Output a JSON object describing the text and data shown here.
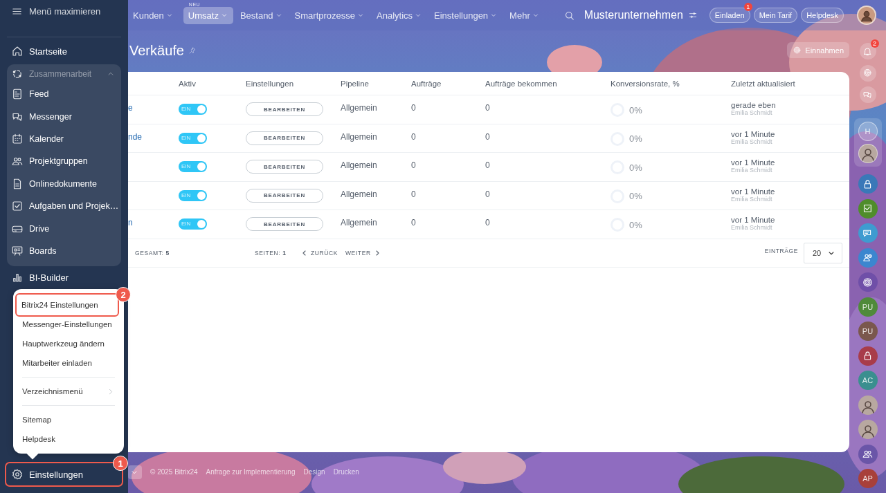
{
  "sidebar": {
    "toggle_label": "Menü maximieren",
    "items": [
      {
        "kind": "home",
        "label": "Startseite"
      }
    ],
    "group": {
      "kind": "collab",
      "label": "Zusammenarbeit",
      "expanded": true,
      "children": [
        {
          "kind": "feed",
          "label": "Feed"
        },
        {
          "kind": "chat",
          "label": "Messenger"
        },
        {
          "kind": "calendar",
          "label": "Kalender"
        },
        {
          "kind": "people",
          "label": "Projektgruppen"
        },
        {
          "kind": "document",
          "label": "Onlinedokumente"
        },
        {
          "kind": "task",
          "label": "Aufgaben und Projek…"
        },
        {
          "kind": "drive",
          "label": "Drive"
        },
        {
          "kind": "board",
          "label": "Boards"
        }
      ]
    },
    "after_items": [
      {
        "kind": "chart",
        "label": "BI-Builder"
      }
    ],
    "settings_item": {
      "kind": "gear",
      "label": "Einstellungen",
      "annotation": "1"
    }
  },
  "settings_menu": {
    "items": [
      {
        "kind": "item",
        "label": "Bitrix24 Einstellungen",
        "annotation": "2"
      },
      {
        "kind": "item",
        "label": "Messenger-Einstellungen"
      },
      {
        "kind": "item",
        "label": "Hauptwerkzeug ändern"
      },
      {
        "kind": "item",
        "label": "Mitarbeiter einladen"
      },
      {
        "kind": "divider"
      },
      {
        "kind": "submenu",
        "label": "Verzeichnismenü"
      },
      {
        "kind": "divider"
      },
      {
        "kind": "item",
        "label": "Sitemap"
      },
      {
        "kind": "item",
        "label": "Helpdesk"
      }
    ]
  },
  "topbar": {
    "nav": [
      {
        "label": "Kunden",
        "selected": false
      },
      {
        "label": "Umsatz",
        "selected": true,
        "badge": "NEU"
      },
      {
        "label": "Bestand",
        "selected": false
      },
      {
        "label": "Smartprozesse",
        "selected": false
      },
      {
        "label": "Analytics",
        "selected": false
      },
      {
        "label": "Einstellungen",
        "selected": false
      },
      {
        "label": "Mehr",
        "selected": false
      }
    ],
    "company": "Musterunternehmen",
    "buttons": [
      {
        "label": "Einladen",
        "badge": "1"
      },
      {
        "label": "Mein Tarif"
      },
      {
        "label": "Helpdesk"
      }
    ]
  },
  "page": {
    "title": "Verkäufe",
    "action": "Einnahmen"
  },
  "table": {
    "columns": [
      "Aktiv",
      "Einstellungen",
      "Pipeline",
      "Aufträge",
      "Aufträge bekommen",
      "Konversionsrate, %",
      "Zuletzt aktualisiert"
    ],
    "rows": [
      {
        "name": "e",
        "active": true,
        "toggle_label": "EIN",
        "settings": "BEARBEITEN",
        "pipeline": "Allgemein",
        "orders": "0",
        "won": "0",
        "conversion": "0%",
        "updated": "gerade eben",
        "author": "Emilia Schmidt"
      },
      {
        "name": "nde",
        "active": true,
        "toggle_label": "EIN",
        "settings": "BEARBEITEN",
        "pipeline": "Allgemein",
        "orders": "0",
        "won": "0",
        "conversion": "0%",
        "updated": "vor 1 Minute",
        "author": "Emilia Schmidt"
      },
      {
        "active": true,
        "toggle_label": "EIN",
        "settings": "BEARBEITEN",
        "pipeline": "Allgemein",
        "orders": "0",
        "won": "0",
        "conversion": "0%",
        "updated": "vor 1 Minute",
        "author": "Emilia Schmidt"
      },
      {
        "active": true,
        "toggle_label": "EIN",
        "settings": "BEARBEITEN",
        "pipeline": "Allgemein",
        "orders": "0",
        "won": "0",
        "conversion": "0%",
        "updated": "vor 1 Minute",
        "author": "Emilia Schmidt"
      },
      {
        "name": "n",
        "active": true,
        "toggle_label": "EIN",
        "settings": "BEARBEITEN",
        "pipeline": "Allgemein",
        "orders": "0",
        "won": "0",
        "conversion": "0%",
        "updated": "vor 1 Minute",
        "author": "Emilia Schmidt"
      }
    ],
    "pagination": {
      "total": "GESAMT: **5**",
      "pages": "SEITEN: **1**",
      "prev": "ZURÜCK",
      "next": "WEITER",
      "per_page_label": "EINTRÄGE",
      "per_page": "20"
    }
  },
  "footer": {
    "copyright": "© 2025 Bitrix24",
    "links": [
      "Anfrage zur Implementierung",
      "Design",
      "Drucken"
    ]
  },
  "rail": {
    "top": [
      {
        "kind": "bell",
        "badge": "2"
      },
      {
        "kind": "spiral"
      },
      {
        "kind": "chat"
      }
    ],
    "pinned": [
      {
        "kind": "initials",
        "text": "H"
      },
      {
        "kind": "avatar"
      }
    ],
    "chats": [
      {
        "kind": "lock",
        "color": "#3a78b8"
      },
      {
        "kind": "check",
        "color": "#4f8d2a"
      },
      {
        "kind": "messages",
        "color": "#3f9bd0"
      },
      {
        "kind": "contact",
        "color": "#3b86cf"
      },
      {
        "kind": "spiral",
        "color": "#6f4fa8"
      },
      {
        "kind": "initials",
        "text": "PU",
        "color": "#4f8a3a"
      },
      {
        "kind": "initials",
        "text": "PU",
        "color": "#7a574d"
      },
      {
        "kind": "lock",
        "color": "#a83c4a"
      },
      {
        "kind": "initials",
        "text": "AC",
        "color": "#3a8f8f"
      },
      {
        "kind": "avatar"
      },
      {
        "kind": "avatar"
      },
      {
        "kind": "people",
        "color": "#6a55a8"
      },
      {
        "kind": "initials",
        "text": "AP",
        "color": "#a8403a"
      }
    ]
  }
}
